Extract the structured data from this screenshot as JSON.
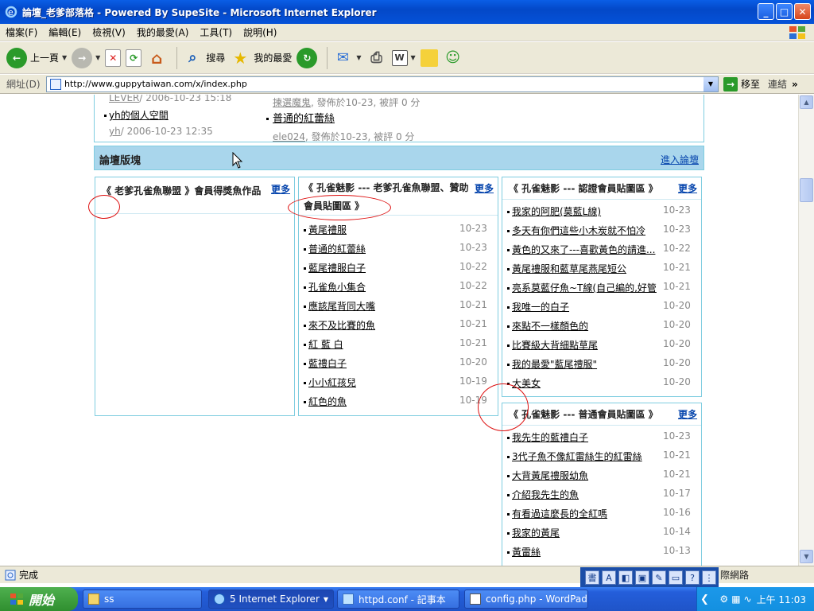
{
  "window": {
    "title": "論壇_老爹部落格 - Powered By SupeSite - Microsoft Internet Explorer",
    "buttons": {
      "minimize": "_",
      "maximize": "□",
      "close": "✕"
    }
  },
  "menu": [
    "檔案(F)",
    "編輯(E)",
    "檢視(V)",
    "我的最愛(A)",
    "工具(T)",
    "說明(H)"
  ],
  "toolbar": {
    "back": "上一頁",
    "search": "搜尋",
    "favorites": "我的最愛"
  },
  "address": {
    "label": "網址(D)",
    "url": "http://www.guppytaiwan.com/x/index.php",
    "go": "移至",
    "links": "連結"
  },
  "top_fragments": {
    "left_user1": "LEVER",
    "left_time1": "/ 2006-10-23 15:18",
    "left_title": "yh的個人空間",
    "left_user2": "yh",
    "left_time2": "/ 2006-10-23 12:35",
    "mid_user1": "揀選魔鬼",
    "mid_meta1": ", 發佈於10-23, 被評 0 分",
    "mid_title": "普通的紅蕾絲",
    "mid_user2": "ele024",
    "mid_meta2": ", 發佈於10-23, 被評 0 分"
  },
  "section_bar": {
    "title": "論壇版塊",
    "link": "進入論壇"
  },
  "panel1": {
    "title": "《 老爹孔雀魚聯盟 》會員得獎魚作品",
    "more": "更多"
  },
  "panel2": {
    "title": "《 孔雀魅影 --- 老爹孔雀魚聯盟、贊助會員貼圖區 》",
    "more": "更多",
    "items": [
      {
        "t": "黃尾禮服",
        "d": "10-23"
      },
      {
        "t": "普通的紅蕾絲",
        "d": "10-23"
      },
      {
        "t": "藍尾禮服白子",
        "d": "10-22"
      },
      {
        "t": "孔雀魚小集合",
        "d": "10-22"
      },
      {
        "t": "應該尾背同大嘴",
        "d": "10-21"
      },
      {
        "t": "來不及比賽的魚",
        "d": "10-21"
      },
      {
        "t": "紅 藍 白",
        "d": "10-21"
      },
      {
        "t": "藍禮白子",
        "d": "10-20"
      },
      {
        "t": "小小紅孩兒",
        "d": "10-19"
      },
      {
        "t": "紅色的魚",
        "d": "10-19"
      }
    ]
  },
  "panel3": {
    "title": "《 孔雀魅影 --- 認證會員貼圖區 》",
    "more": "更多",
    "items": [
      {
        "t": "我家的阿肥(莫藍L線)",
        "d": "10-23"
      },
      {
        "t": "多天有你們這些小木炭就不怕冷",
        "d": "10-23"
      },
      {
        "t": "黃色的又來了---喜歡黃色的請進...",
        "d": "10-22"
      },
      {
        "t": "黃尾禮服和藍草尾燕尾短公",
        "d": "10-21"
      },
      {
        "t": "亮系莫藍仔魚~T線(自己編的,好管",
        "d": "10-21"
      },
      {
        "t": "我唯一的白子",
        "d": "10-20"
      },
      {
        "t": "來點不一樣顏色的",
        "d": "10-20"
      },
      {
        "t": "比賽級大背細點草尾",
        "d": "10-20"
      },
      {
        "t": "我的最愛\"藍尾禮服\"",
        "d": "10-20"
      },
      {
        "t": "大美女",
        "d": "10-20"
      }
    ]
  },
  "panel4": {
    "title": "《 孔雀魅影 --- 普通會員貼圖區 》",
    "more": "更多",
    "items": [
      {
        "t": "我先生的藍禮白子",
        "d": "10-23"
      },
      {
        "t": "3代子魚不像紅雷絲生的紅雷絲",
        "d": "10-21"
      },
      {
        "t": "大背黃尾禮服幼魚",
        "d": "10-21"
      },
      {
        "t": "介紹我先生的魚",
        "d": "10-17"
      },
      {
        "t": "有看過這麼長的全紅嗎",
        "d": "10-16"
      },
      {
        "t": "我家的黃尾",
        "d": "10-14"
      },
      {
        "t": "黃雷絲",
        "d": "10-13"
      }
    ]
  },
  "status": {
    "text": "完成",
    "zone": "際網路"
  },
  "ime": [
    "書",
    "A",
    "◧",
    "▣",
    "✎",
    "▭",
    "?",
    "⋮"
  ],
  "taskbar": {
    "start": "開始",
    "tasks": [
      "ss",
      "5 Internet Explorer",
      "httpd.conf - 記事本",
      "config.php - WordPad"
    ],
    "clock": "上午 11:03"
  },
  "colors": {
    "panel_border": "#7fcde0",
    "section_bar": "#a9d6ec",
    "annotation": "#d11111"
  }
}
